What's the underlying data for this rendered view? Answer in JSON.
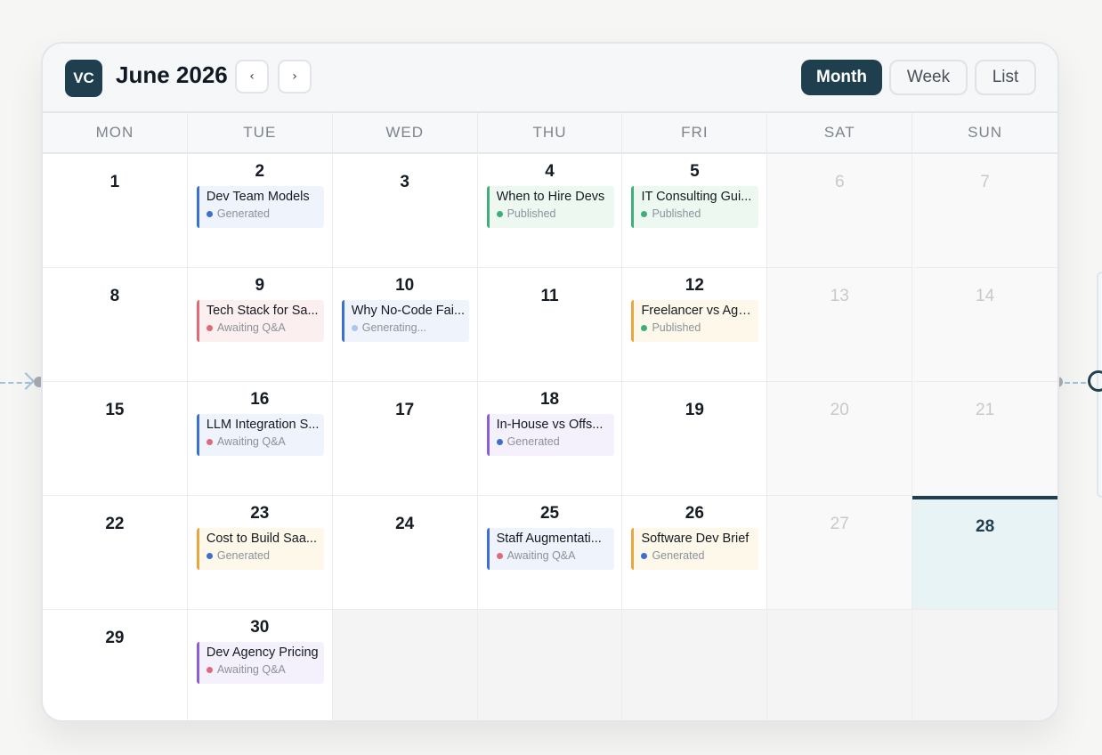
{
  "app": {
    "logo_text": "VC",
    "title": "June 2026"
  },
  "nav": {
    "prev_label": "‹",
    "next_label": "›"
  },
  "views": {
    "month": "Month",
    "week": "Week",
    "list": "List",
    "active": "Month"
  },
  "weekdays": [
    "MON",
    "TUE",
    "WED",
    "THU",
    "FRI",
    "SAT",
    "SUN"
  ],
  "colors": {
    "accent": "#1f3f4f",
    "status": {
      "Generated": "#3d6fd1",
      "Published": "#3fae7a",
      "Awaiting Q&A": "#e06a78",
      "Generating...": "#a8c6f0"
    }
  },
  "weeks": [
    {
      "days": [
        {
          "num": "1",
          "event": null
        },
        {
          "num": "2",
          "event": {
            "title": "Dev Team Models",
            "status": "Generated",
            "bar": "#3d6fd1",
            "bg": "#eef3fc"
          }
        },
        {
          "num": "3",
          "event": null
        },
        {
          "num": "4",
          "event": {
            "title": "When to Hire Devs",
            "status": "Published",
            "bar": "#3fae7a",
            "bg": "#edf8f1"
          }
        },
        {
          "num": "5",
          "event": {
            "title": "IT Consulting Gui...",
            "status": "Published",
            "bar": "#3fae7a",
            "bg": "#edf8f1"
          }
        },
        {
          "num": "6",
          "weekend": true
        },
        {
          "num": "7",
          "weekend": true
        }
      ]
    },
    {
      "days": [
        {
          "num": "8",
          "event": null
        },
        {
          "num": "9",
          "event": {
            "title": "Tech Stack for Sa...",
            "status": "Awaiting Q&A",
            "bar": "#e06a78",
            "bg": "#fcefef"
          }
        },
        {
          "num": "10",
          "event": {
            "title": "Why No-Code Fai...",
            "status": "Generating...",
            "bar": "#3d6fd1",
            "bg": "#eef3fc"
          }
        },
        {
          "num": "11",
          "event": null
        },
        {
          "num": "12",
          "event": {
            "title": "Freelancer vs Age...",
            "status": "Published",
            "bar": "#e8a640",
            "bg": "#fdf8ea"
          }
        },
        {
          "num": "13",
          "weekend": true
        },
        {
          "num": "14",
          "weekend": true
        }
      ]
    },
    {
      "days": [
        {
          "num": "15",
          "event": null
        },
        {
          "num": "16",
          "event": {
            "title": "LLM Integration S...",
            "status": "Awaiting Q&A",
            "bar": "#3d6fd1",
            "bg": "#eef3fc"
          }
        },
        {
          "num": "17",
          "event": null
        },
        {
          "num": "18",
          "event": {
            "title": "In-House vs Offs...",
            "status": "Generated",
            "bar": "#8a5fd6",
            "bg": "#f5f1fc"
          }
        },
        {
          "num": "19",
          "event": null
        },
        {
          "num": "20",
          "weekend": true
        },
        {
          "num": "21",
          "weekend": true
        }
      ]
    },
    {
      "days": [
        {
          "num": "22",
          "event": null
        },
        {
          "num": "23",
          "event": {
            "title": "Cost to Build Saa...",
            "status": "Generated",
            "bar": "#e8a640",
            "bg": "#fdf8ea"
          }
        },
        {
          "num": "24",
          "event": null
        },
        {
          "num": "25",
          "event": {
            "title": "Staff Augmentati...",
            "status": "Awaiting Q&A",
            "bar": "#3d6fd1",
            "bg": "#eef3fc"
          }
        },
        {
          "num": "26",
          "event": {
            "title": "Software Dev Brief",
            "status": "Generated",
            "bar": "#e8a640",
            "bg": "#fdf8ea"
          }
        },
        {
          "num": "27",
          "weekend": true
        },
        {
          "num": "28",
          "today": true
        }
      ]
    },
    {
      "days": [
        {
          "num": "29",
          "event": null
        },
        {
          "num": "30",
          "event": {
            "title": "Dev Agency Pricing",
            "status": "Awaiting Q&A",
            "bar": "#8a5fd6",
            "bg": "#f5f1fc"
          }
        },
        {
          "empty": true
        },
        {
          "empty": true
        },
        {
          "empty": true
        },
        {
          "empty": true
        },
        {
          "empty": true
        }
      ]
    }
  ]
}
